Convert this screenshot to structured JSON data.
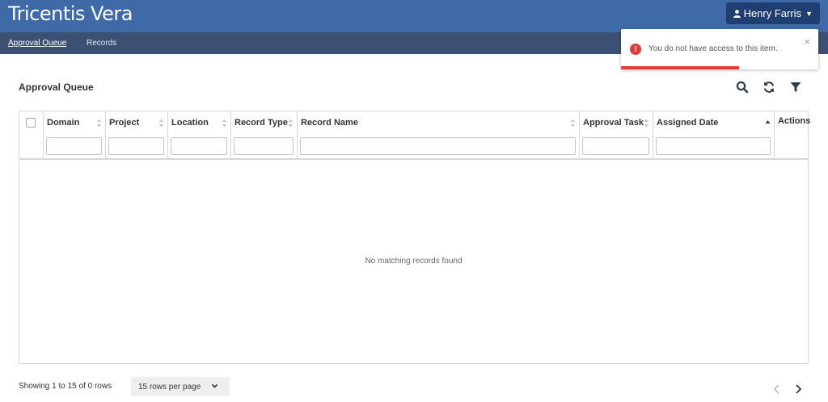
{
  "app": {
    "brand": "Tricentis Vera"
  },
  "user": {
    "name": "Henry Farris",
    "icon": "user-icon"
  },
  "nav": {
    "items": [
      {
        "label": "Approval Queue",
        "active": true
      },
      {
        "label": "Records",
        "active": false
      }
    ]
  },
  "page": {
    "title": "Approval Queue"
  },
  "toolbar": {
    "icons": [
      "search-icon",
      "refresh-icon",
      "filter-icon"
    ]
  },
  "table": {
    "columns": [
      {
        "label": "Domain",
        "sort": "none",
        "filter_value": ""
      },
      {
        "label": "Project",
        "sort": "none",
        "filter_value": ""
      },
      {
        "label": "Location",
        "sort": "none",
        "filter_value": ""
      },
      {
        "label": "Record Type",
        "sort": "none",
        "filter_value": ""
      },
      {
        "label": "Record Name",
        "sort": "none",
        "filter_value": ""
      },
      {
        "label": "Approval Task",
        "sort": "none",
        "filter_value": ""
      },
      {
        "label": "Assigned Date",
        "sort": "ascending",
        "filter_value": ""
      },
      {
        "label": "Actions"
      }
    ],
    "empty_message": "No matching records found"
  },
  "footer": {
    "info": "Showing 1 to 15 of 0 rows",
    "rows_per_page": "15 rows per page",
    "icons": [
      "chevron-left-icon",
      "chevron-right-icon"
    ]
  },
  "toast": {
    "message": "You do not have access to this item.",
    "icon": "error-icon",
    "close": "×",
    "progress": 0.6
  },
  "colors": {
    "topbar": "#3f6aa8",
    "navbar": "#3c5073",
    "user_button": "#1f3f72",
    "error": "#e53935"
  }
}
